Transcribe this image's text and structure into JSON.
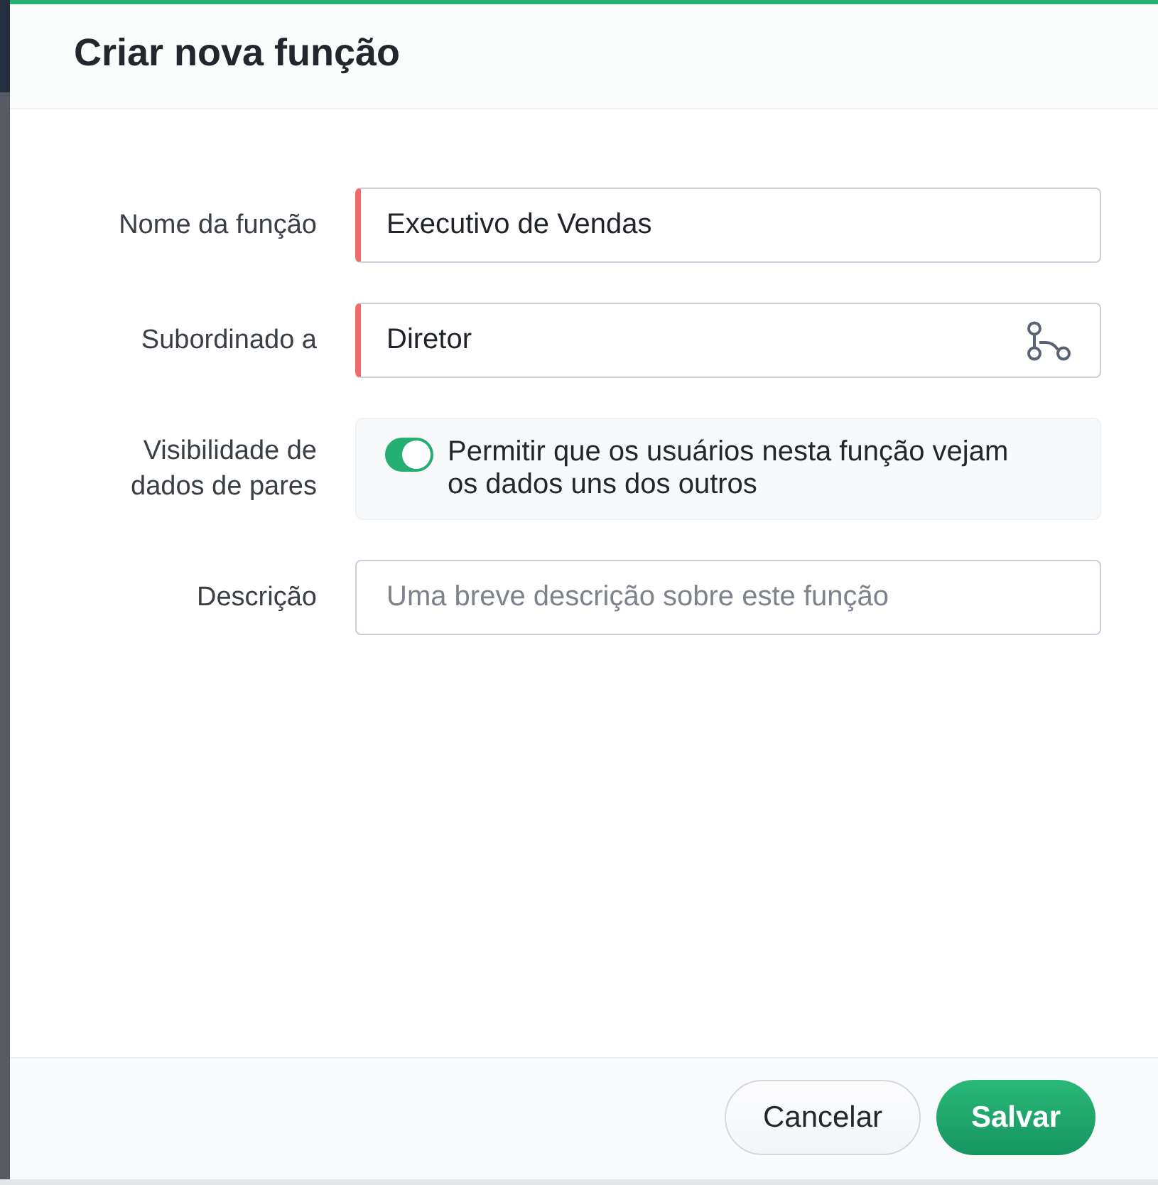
{
  "dialog": {
    "title": "Criar nova função"
  },
  "fields": [
    {
      "kind": "text",
      "label": "Nome da função",
      "value": "Executivo de Vendas",
      "required": true
    },
    {
      "kind": "picker",
      "label": "Subordinado a",
      "value": "Diretor",
      "required": true
    },
    {
      "kind": "toggle",
      "label": "Visibilidade de dados de pares",
      "text": "Permitir que os usuários nesta função vejam os dados uns dos outros",
      "on": true
    },
    {
      "kind": "text",
      "label": "Descrição",
      "placeholder": "Uma breve descrição sobre este função",
      "required": false
    }
  ],
  "buttons": [
    {
      "label": "Cancelar",
      "kind": "secondary"
    },
    {
      "label": "Salvar",
      "kind": "primary"
    }
  ]
}
